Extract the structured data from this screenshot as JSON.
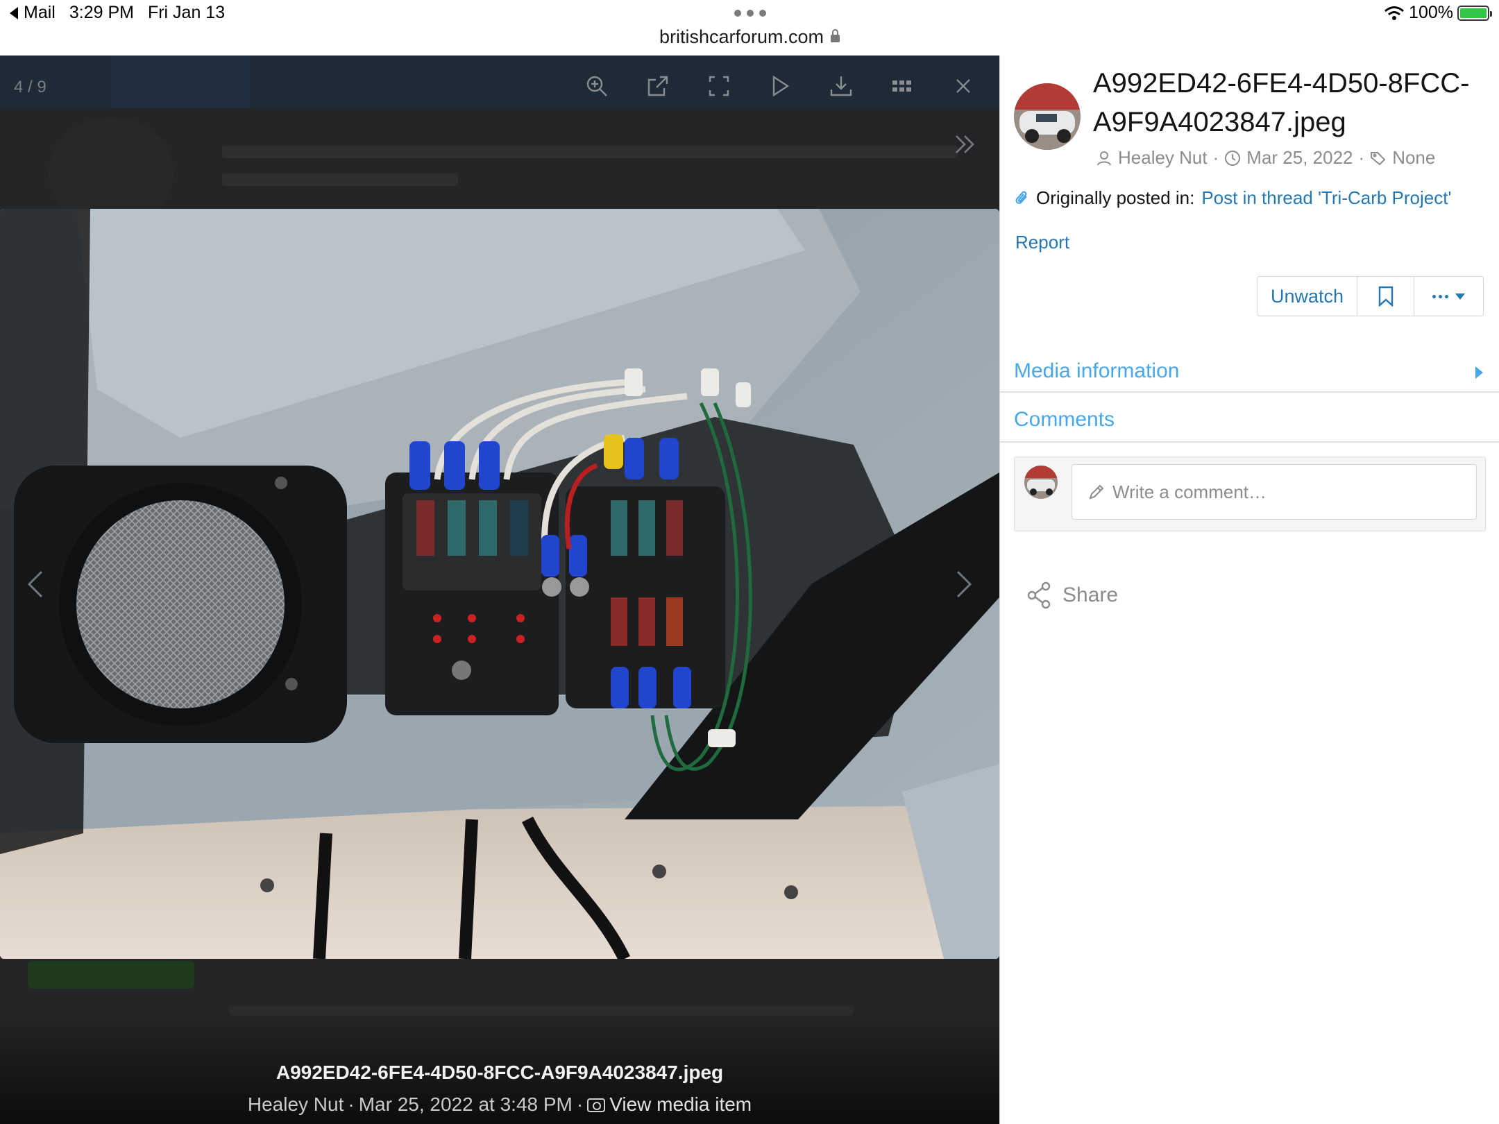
{
  "status_bar": {
    "back_app": "Mail",
    "time": "3:29 PM",
    "date": "Fri Jan 13",
    "url": "britishcarforum.com",
    "battery": "100%"
  },
  "lightbox": {
    "counter": "4 / 9",
    "toolbar": [
      "zoom-icon",
      "open-external-icon",
      "fullscreen-icon",
      "slideshow-play-icon",
      "download-icon",
      "thumbnails-icon",
      "close-icon"
    ],
    "caption": {
      "filename": "A992ED42-6FE4-4D50-8FCC-A9F9A4023847.jpeg",
      "author": "Healey Nut",
      "date": "Mar 25, 2022 at 3:48 PM",
      "view_link": "View media item"
    }
  },
  "sidebar": {
    "title": "A992ED42-6FE4-4D50-8FCC-A9F9A4023847.jpeg",
    "author": "Healey Nut",
    "date": "Mar 25, 2022",
    "tags": "None",
    "originally_posted_label": "Originally posted in:",
    "originally_posted_link": "Post in thread 'Tri-Carb Project'",
    "report": "Report",
    "buttons": {
      "unwatch": "Unwatch"
    },
    "sections": {
      "media_information": "Media information",
      "comments": "Comments"
    },
    "comment_placeholder": "Write a comment…",
    "share": "Share"
  },
  "colors": {
    "link": "#2577b1",
    "section_header": "#47a7eb",
    "lightbox_bg": "#232526"
  }
}
